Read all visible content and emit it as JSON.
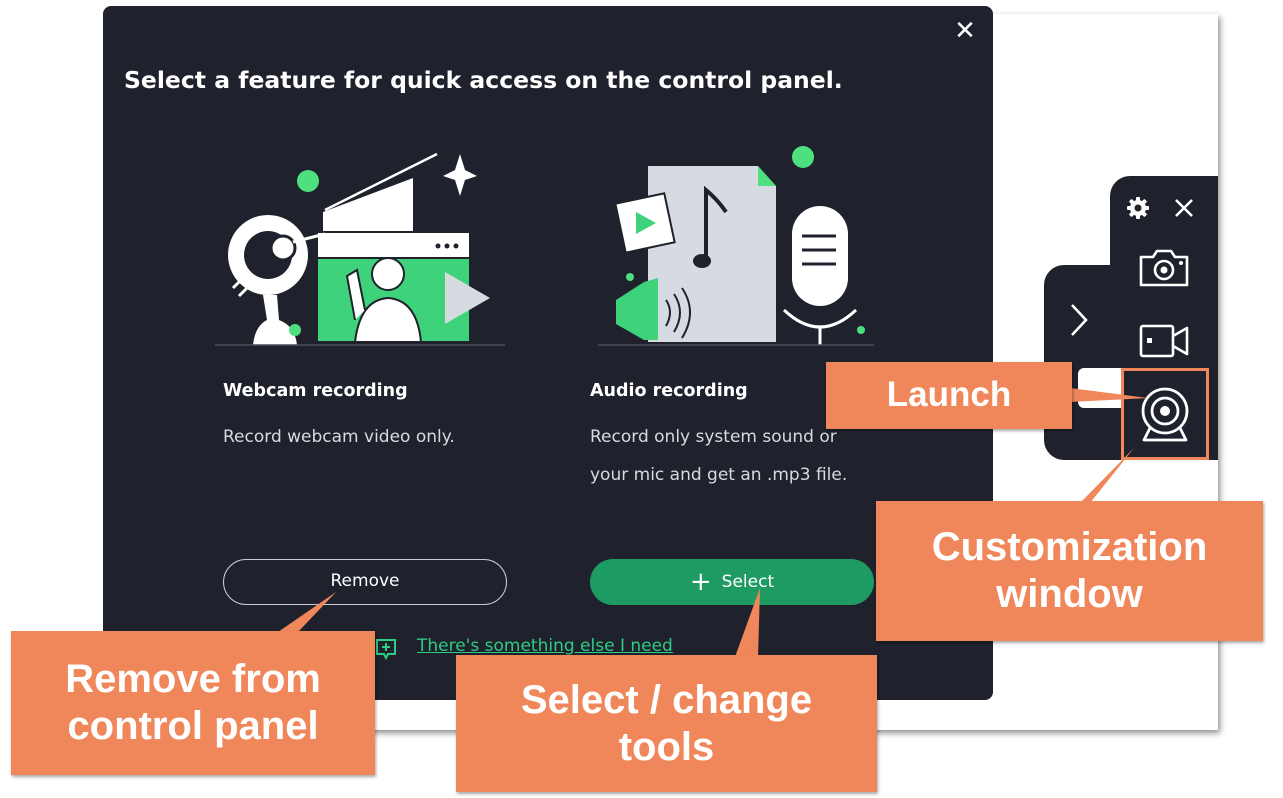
{
  "dialog": {
    "title": "Select a feature for quick access on the control panel.",
    "close_icon": "close-icon",
    "features": [
      {
        "title": "Webcam recording",
        "description": "Record webcam video only.",
        "button_label": "Remove"
      },
      {
        "title": "Audio recording",
        "description": "Record only system sound or your mic and get an .mp3 file.",
        "button_label": "Select"
      }
    ],
    "feedback_link": "There's something else I need"
  },
  "control_panel": {
    "icons": [
      "gear-icon",
      "close-icon",
      "chevron-right-icon",
      "camera-icon",
      "video-camera-icon",
      "webcam-icon"
    ]
  },
  "callouts": {
    "launch": "Launch",
    "customization": "Customization window",
    "remove": "Remove from control panel",
    "select": "Select / change tools"
  },
  "colors": {
    "dialog_bg": "#1f222c",
    "accent_green": "#1e9a63",
    "link_green": "#2ecc84",
    "callout_orange": "#f0875a",
    "highlight_orange": "#f0875a"
  }
}
